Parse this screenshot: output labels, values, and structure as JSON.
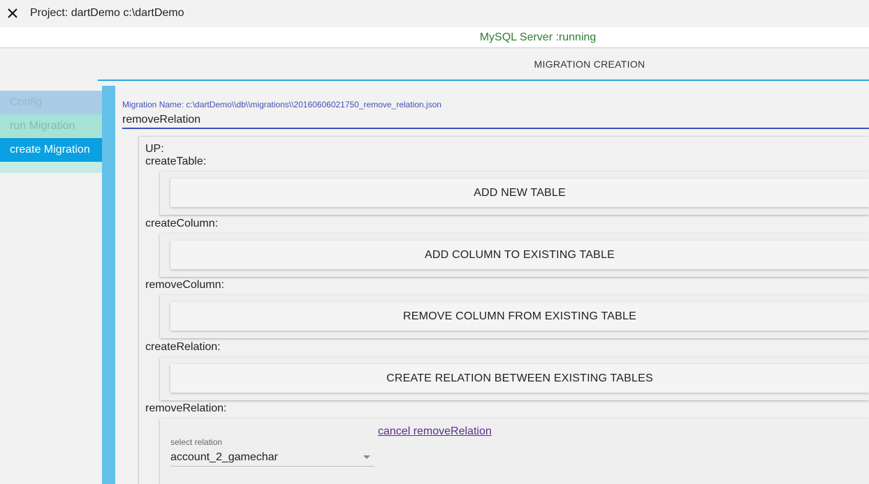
{
  "window": {
    "title": "Project: dartDemo c:\\dartDemo",
    "close_icon": "close-icon"
  },
  "status": {
    "text": "MySQL Server :running",
    "color": "#2e7d32"
  },
  "tab": {
    "label": "MIGRATION CREATION",
    "accent": "#29a8e0"
  },
  "sidebar": {
    "items": [
      {
        "label": "Config",
        "active": false
      },
      {
        "label": "run Migration",
        "active": false
      },
      {
        "label": "create Migration",
        "active": true
      }
    ]
  },
  "migration": {
    "name_label": "Migration Name: c:\\dartDemo\\\\db\\\\migrations\\\\20160606021750_remove_relation.json",
    "name_value": "removeRelation"
  },
  "up": {
    "heading": "UP:",
    "sections": [
      {
        "label": "createTable:",
        "button": "ADD NEW TABLE"
      },
      {
        "label": "createColumn:",
        "button": "ADD COLUMN TO EXISTING TABLE"
      },
      {
        "label": "removeColumn:",
        "button": "REMOVE COLUMN FROM EXISTING TABLE"
      },
      {
        "label": "createRelation:",
        "button": "CREATE RELATION BETWEEN EXISTING TABLES"
      },
      {
        "label": "removeRelation:"
      }
    ],
    "remove_relation": {
      "cancel_link": "cancel removeRelation",
      "select_label": "select relation",
      "select_value": "account_2_gamechar"
    }
  }
}
